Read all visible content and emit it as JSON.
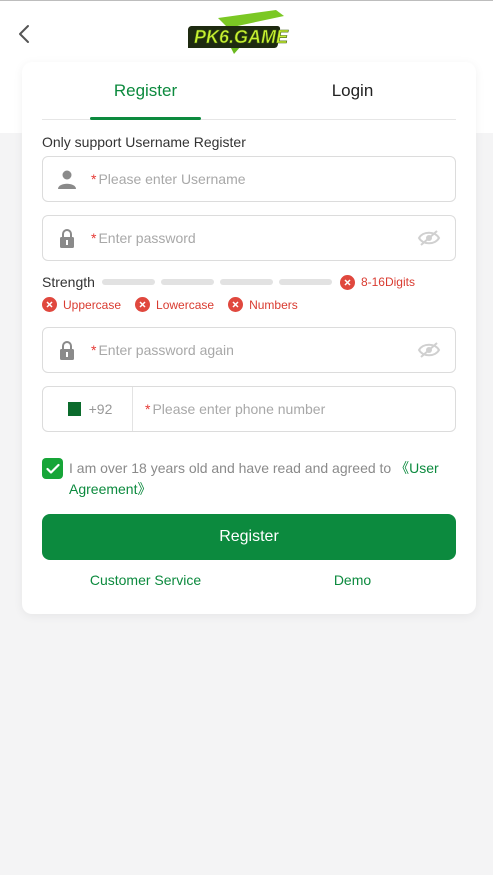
{
  "header": {
    "back_icon": "chevron-left-icon",
    "logo_text": "PK6.GAME"
  },
  "tabs": [
    {
      "label": "Register",
      "active": true
    },
    {
      "label": "Login",
      "active": false
    }
  ],
  "hint": "Only support Username Register",
  "fields": {
    "username": {
      "required_mark": "*",
      "placeholder": "Please enter Username",
      "icon": "user-icon"
    },
    "password": {
      "required_mark": "*",
      "placeholder": "Enter password",
      "icon": "lock-icon",
      "toggle_icon": "eye-off-icon"
    },
    "password_again": {
      "required_mark": "*",
      "placeholder": "Enter password again",
      "icon": "lock-icon",
      "toggle_icon": "eye-off-icon"
    },
    "phone": {
      "country_code": "+92",
      "flag": "pakistan-flag-icon",
      "required_mark": "*",
      "placeholder": "Please enter phone number"
    }
  },
  "strength": {
    "label": "Strength",
    "bars": 4,
    "rules": [
      "8-16Digits",
      "Uppercase",
      "Lowercase",
      "Numbers"
    ]
  },
  "agreement": {
    "checked": true,
    "text": "I am over 18 years old and have read and agreed to ",
    "link": "《User Agreement》"
  },
  "register_button": "Register",
  "links": {
    "customer_service": "Customer Service",
    "demo": "Demo"
  },
  "colors": {
    "brand_green": "#0c8a3e",
    "error_red": "#e0483e",
    "checkbox_green": "#17a538"
  }
}
